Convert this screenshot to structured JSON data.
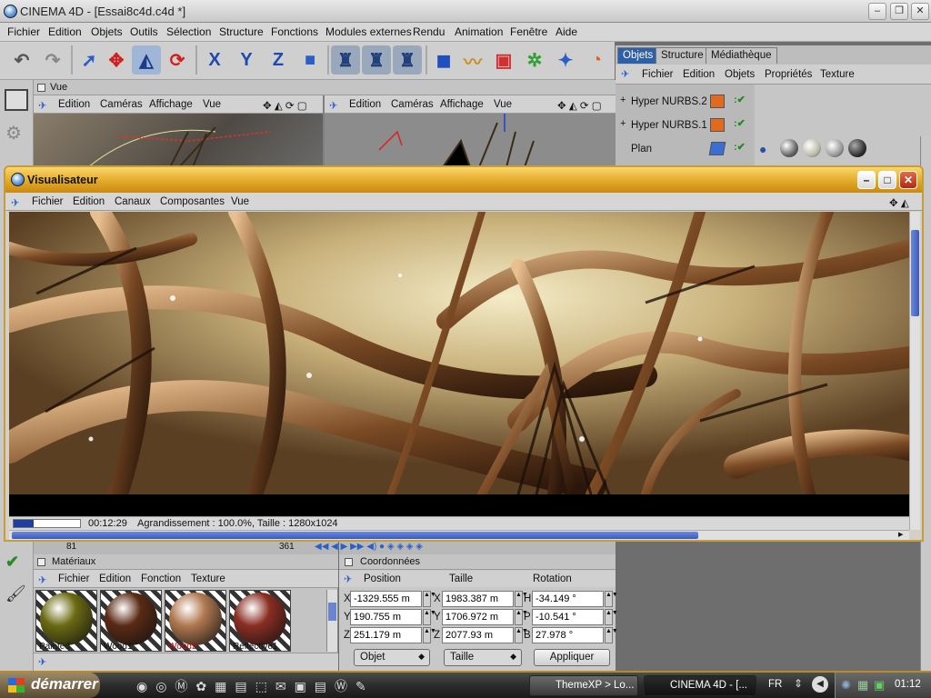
{
  "window": {
    "title": "CINEMA 4D - [Essai8c4d.c4d *]"
  },
  "menubar": [
    "Fichier",
    "Edition",
    "Objets",
    "Outils",
    "Sélection",
    "Structure",
    "Fonctions",
    "Modules externes",
    "Rendu",
    "Animation",
    "Fenêtre",
    "Aide"
  ],
  "toolbar": {
    "axis_labels": [
      "X",
      "Y",
      "Z"
    ]
  },
  "viewport": {
    "panel_title": "Vue",
    "menu": [
      "Edition",
      "Caméras",
      "Affichage",
      "Vue"
    ]
  },
  "object_manager": {
    "tabs": [
      "Objets",
      "Structure",
      "Médiathèque"
    ],
    "menu": [
      "Fichier",
      "Edition",
      "Objets",
      "Propriétés",
      "Texture"
    ],
    "objects": [
      {
        "name": "Hyper NURBS.2",
        "expand": "+"
      },
      {
        "name": "Hyper NURBS.1",
        "expand": "+"
      },
      {
        "name": "Plan",
        "expand": ""
      }
    ]
  },
  "viewer": {
    "title": "Visualisateur",
    "menu": [
      "Fichier",
      "Edition",
      "Canaux",
      "Composantes",
      "Vue"
    ],
    "status_time": "00:12:29",
    "status_text": "Agrandissement : 100.0%, Taille : 1280x1024"
  },
  "materials": {
    "panel_title": "Matériaux",
    "menu": [
      "Fichier",
      "Edition",
      "Fonction",
      "Texture"
    ],
    "frame_labels": [
      "81",
      "361"
    ],
    "items": [
      {
        "name": "Painted",
        "color": "#6b6a12"
      },
      {
        "name": "Wood1",
        "color": "#5a2a14"
      },
      {
        "name": "Wood2",
        "color": "#b07850"
      },
      {
        "name": "Reflective1",
        "color": "#8a2e22"
      }
    ]
  },
  "coordinates": {
    "panel_title": "Coordonnées",
    "headers": [
      "Position",
      "Taille",
      "Rotation"
    ],
    "rows": [
      {
        "pos_axis": "X",
        "pos": "-1329.555 m",
        "size_axis": "X",
        "size": "1983.387 m",
        "rot_axis": "H",
        "rot": "-34.149 °"
      },
      {
        "pos_axis": "Y",
        "pos": "190.755 m",
        "size_axis": "Y",
        "size": "1706.972 m",
        "rot_axis": "P",
        "rot": "-10.541 °"
      },
      {
        "pos_axis": "Z",
        "pos": "251.179 m",
        "size_axis": "Z",
        "size": "2077.93 m",
        "rot_axis": "B",
        "rot": "27.978 °"
      }
    ],
    "mode_select": "Objet",
    "size_select": "Taille",
    "apply_label": "Appliquer"
  },
  "taskbar": {
    "start_label": "démarrer",
    "tasks": [
      {
        "label": "ThemeXP > Lo..."
      },
      {
        "label": "CINEMA 4D - [..."
      }
    ],
    "language": "FR",
    "clock": "01:12"
  }
}
